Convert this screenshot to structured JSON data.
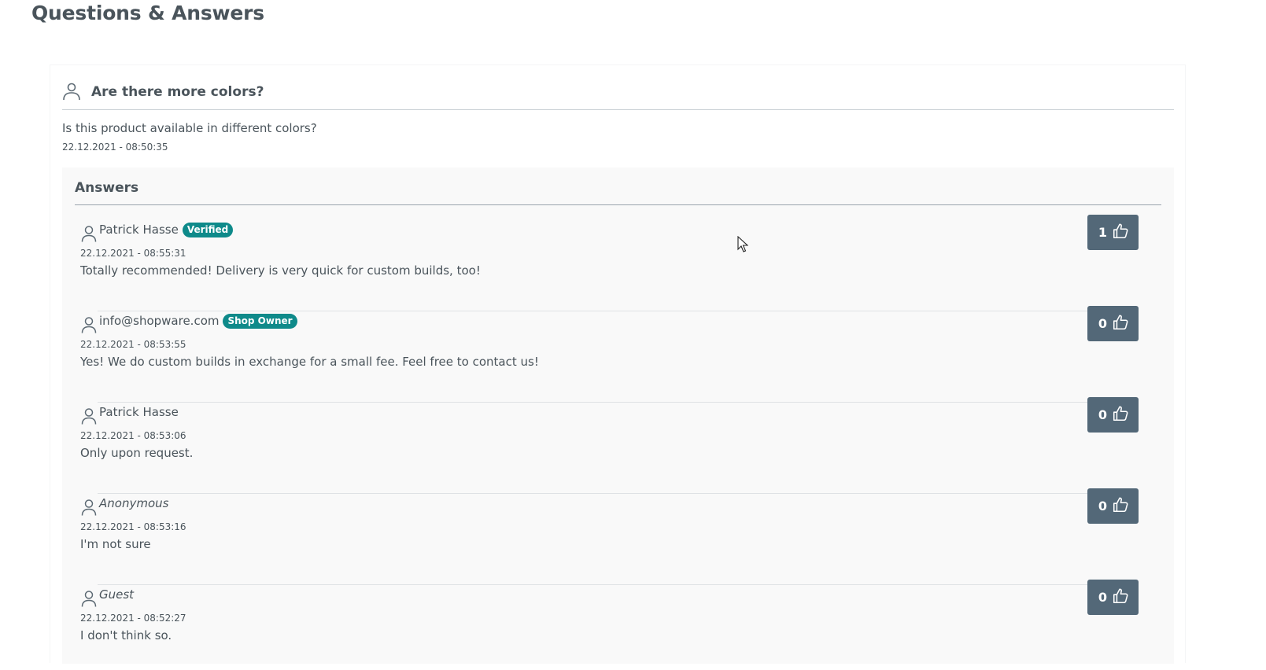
{
  "page": {
    "title": "Questions & Answers"
  },
  "question": {
    "title": "Are there more colors?",
    "text": "Is this product available in different colors?",
    "date": "22.12.2021 - 08:50:35",
    "icon": "user-icon"
  },
  "answers_heading": "Answers",
  "answers": [
    {
      "author": "Patrick Hasse",
      "badge": "Verified",
      "date": "22.12.2021 - 08:55:31",
      "text": "Totally recommended! Delivery is very quick for custom builds, too!",
      "likes": "1",
      "anonymous": false
    },
    {
      "author": "info@shopware.com",
      "badge": "Shop Owner",
      "date": "22.12.2021 - 08:53:55",
      "text": "Yes! We do custom builds in exchange for a small fee. Feel free to contact us!",
      "likes": "0",
      "anonymous": false
    },
    {
      "author": "Patrick Hasse",
      "badge": "",
      "date": "22.12.2021 - 08:53:06",
      "text": "Only upon request.",
      "likes": "0",
      "anonymous": false
    },
    {
      "author": "Anonymous",
      "badge": "",
      "date": "22.12.2021 - 08:53:16",
      "text": "I'm not sure",
      "likes": "0",
      "anonymous": true
    },
    {
      "author": "Guest",
      "badge": "",
      "date": "22.12.2021 - 08:52:27",
      "text": "I don't think so.",
      "likes": "0",
      "anonymous": true
    }
  ],
  "icons": {
    "like": "thumbs-up-icon",
    "user": "user-icon"
  },
  "colors": {
    "badge": "#0e8a8a",
    "like_button": "#536878",
    "answers_bg": "#f9f9f9"
  }
}
